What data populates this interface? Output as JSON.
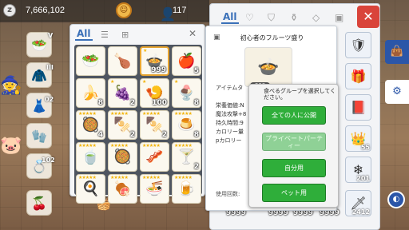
{
  "topbar": {
    "zeny": "7,666,102",
    "count": "117"
  },
  "quick_slots": {
    "labels": [
      "V",
      "III",
      "02",
      "102"
    ]
  },
  "inventory": {
    "tab_all": "All",
    "cells": [
      {
        "icon": "🥗",
        "count": "",
        "sel": false,
        "stars": ""
      },
      {
        "icon": "🍗",
        "count": "",
        "sel": false,
        "stars": ""
      },
      {
        "icon": "🍲",
        "count": "999",
        "sel": true,
        "stars": "★"
      },
      {
        "icon": "🍎",
        "count": "5",
        "sel": false,
        "stars": ""
      },
      {
        "icon": "🍌",
        "count": "8",
        "sel": false,
        "stars": ""
      },
      {
        "icon": "🍇",
        "count": "2",
        "sel": false,
        "stars": "★"
      },
      {
        "icon": "🍤",
        "count": "100",
        "sel": false,
        "stars": "★"
      },
      {
        "icon": "🍨",
        "count": "8",
        "sel": false,
        "stars": "★"
      },
      {
        "icon": "🥘",
        "count": "4",
        "sel": false,
        "stars": "★★★★★"
      },
      {
        "icon": "🍢",
        "count": "2",
        "sel": false,
        "stars": "★★★★★"
      },
      {
        "icon": "🍢",
        "count": "2",
        "sel": false,
        "stars": "★★★★★"
      },
      {
        "icon": "🍮",
        "count": "8",
        "sel": false,
        "stars": "★★★★★"
      },
      {
        "icon": "🍵",
        "count": "",
        "sel": false,
        "stars": "★★★★★"
      },
      {
        "icon": "🥘",
        "count": "",
        "sel": false,
        "stars": "★★★★★"
      },
      {
        "icon": "🥓",
        "count": "",
        "sel": false,
        "stars": "★★★★★"
      },
      {
        "icon": "🍸",
        "count": "2",
        "sel": false,
        "stars": "★★★★★"
      },
      {
        "icon": "🍳",
        "count": "",
        "sel": false,
        "stars": "★★★★★"
      },
      {
        "icon": "🍖",
        "count": "",
        "sel": false,
        "stars": "★★★★★"
      },
      {
        "icon": "🍜",
        "count": "",
        "sel": false,
        "stars": "★★★★★"
      },
      {
        "icon": "🍺",
        "count": "",
        "sel": false,
        "stars": "★★★★★"
      }
    ]
  },
  "storage": {
    "tab_all": "All",
    "right_col_counts": [
      "",
      "",
      "",
      "",
      "55",
      "201",
      "2412"
    ],
    "bottom_nums": [
      "9999",
      "9999",
      "9999",
      "9999"
    ]
  },
  "detail": {
    "title": "初心者のフルーツ盛り",
    "image_count": "999",
    "lines": [
      "アイテムタ",
      "",
      "栄養価値:N",
      "魔法攻撃+8",
      "持久時間:9",
      "カロリー量",
      "pカロリー"
    ],
    "use_count": "使用回数:"
  },
  "popup": {
    "message": "食べるグループを選択してください。",
    "buttons": [
      "全ての人に公開",
      "プライベートパーティー",
      "自分用",
      "ペット用"
    ]
  }
}
